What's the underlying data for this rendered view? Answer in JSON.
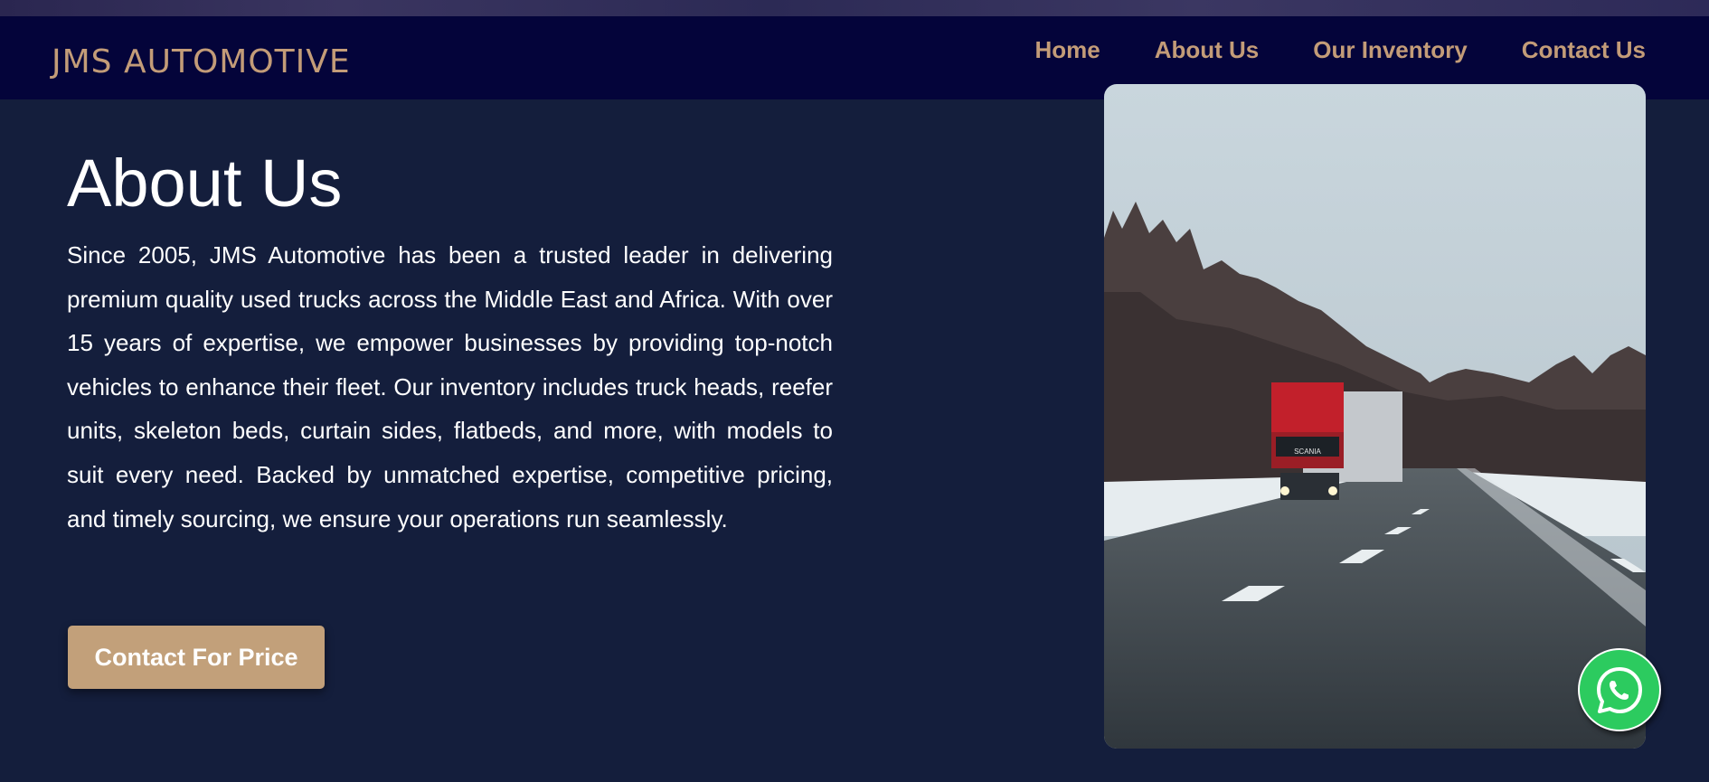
{
  "header": {
    "brand": "JMS AUTOMOTIVE",
    "nav": [
      {
        "label": "Home"
      },
      {
        "label": "About Us"
      },
      {
        "label": "Our Inventory"
      },
      {
        "label": "Contact Us"
      }
    ]
  },
  "about": {
    "title": "About Us",
    "body": "Since 2005, JMS Automotive has been a trusted leader in delivering premium quality used trucks across the Middle East and Africa. With over 15 years of expertise, we empower businesses by providing top-notch vehicles to enhance their fleet. Our inventory includes truck heads, reefer units, skeleton beds, curtain sides, flatbeds, and more, with models to suit every need. Backed by unmatched expertise, competitive pricing, and timely sourcing, we ensure your operations run seamlessly.",
    "cta_label": "Contact For Price"
  },
  "photo": {
    "alt": "Red truck driving on a snowy forest road",
    "truck_badge": "SCANIA"
  },
  "whatsapp": {
    "icon": "whatsapp-icon"
  },
  "colors": {
    "background": "#141e3c",
    "navbar": "#04043a",
    "accent": "#c39c78",
    "button": "#c2a07a",
    "whatsapp": "#2ccb5f"
  }
}
